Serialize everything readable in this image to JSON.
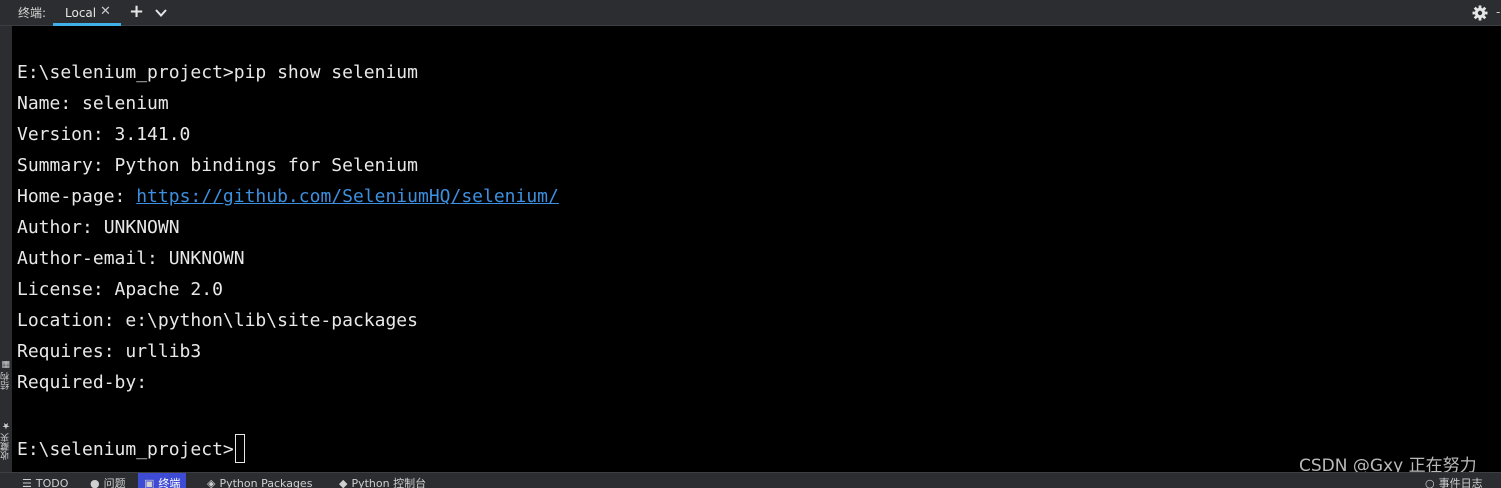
{
  "header": {
    "title": "终端:",
    "tab": {
      "label": "Local",
      "close": "✕"
    },
    "new_tab": "+",
    "icons": [
      "chevron-down-icon",
      "gear-icon"
    ],
    "more": "-"
  },
  "side_tabs": {
    "structure": "结构",
    "favorites": "收藏夹"
  },
  "terminal": {
    "lines": [
      "",
      "E:\\selenium_project>pip show selenium",
      "Name: selenium",
      "Version: 3.141.0",
      "Summary: Python bindings for Selenium",
      "Home-page: ",
      "Author: UNKNOWN",
      "Author-email: UNKNOWN",
      "License: Apache 2.0",
      "Location: e:\\python\\lib\\site-packages",
      "Requires: urllib3",
      "Required-by:",
      "",
      "E:\\selenium_project>"
    ],
    "homepage_url": "https://github.com/SeleniumHQ/selenium/"
  },
  "bottom_bar": {
    "todo": "TODO",
    "problems": "问题",
    "terminal": "终端",
    "python_packages": "Python Packages",
    "python_console": "Python 控制台",
    "event_log": "事件日志"
  },
  "watermark": "CSDN @Gxy 正在努力",
  "colors": {
    "accent": "#3fb1e8",
    "link": "#3d8fe0",
    "active_tool": "#3e4bd4",
    "background": "#000000"
  }
}
